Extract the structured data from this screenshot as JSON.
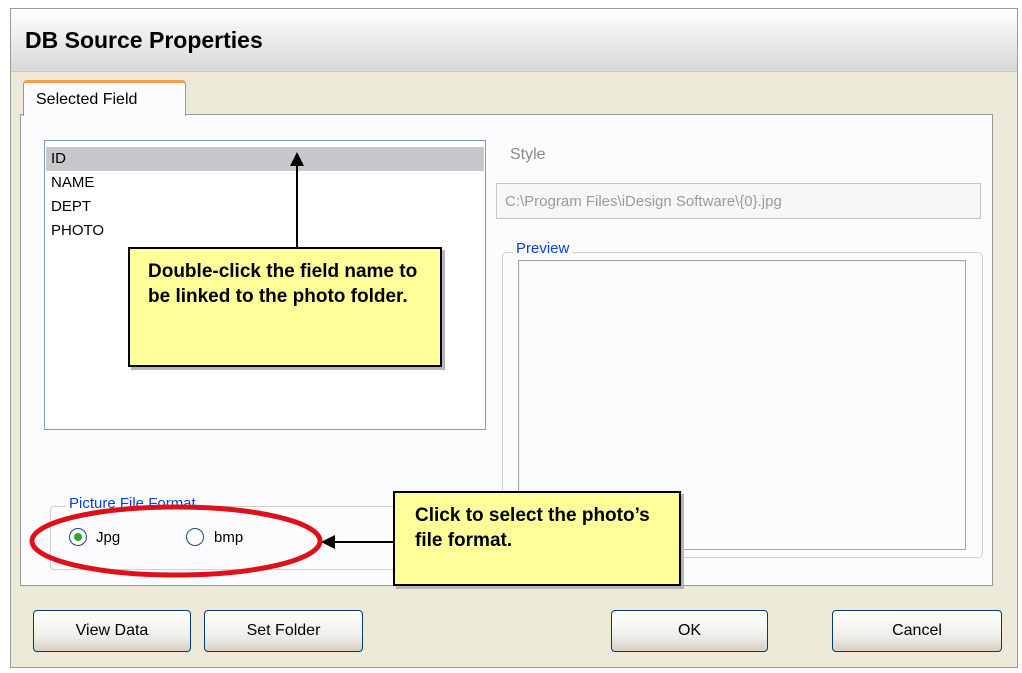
{
  "window": {
    "title": "DB Source Properties"
  },
  "tabs": [
    {
      "label": "Selected Field",
      "active": true
    }
  ],
  "field_list": {
    "items": [
      "ID",
      "NAME",
      "DEPT",
      "PHOTO"
    ],
    "selected": "ID"
  },
  "style": {
    "label": "Style",
    "value": "C:\\Program Files\\iDesign Software\\{0}.jpg"
  },
  "preview": {
    "label": "Preview"
  },
  "picture_format": {
    "label": "Picture File Format",
    "options": [
      {
        "label": "Jpg",
        "checked": true
      },
      {
        "label": "bmp",
        "checked": false
      }
    ]
  },
  "buttons": {
    "view_data": "View Data",
    "set_folder": "Set Folder",
    "ok": "OK",
    "cancel": "Cancel"
  },
  "annotations": {
    "field_tip": "Double-click the field name to be linked to the photo folder.",
    "format_tip": "Click to select the photo’s file format."
  },
  "colors": {
    "callout_bg": "#ffff99",
    "highlight_ellipse": "#e0101a",
    "tab_accent": "#f3a24c",
    "group_label": "#0046d5"
  }
}
